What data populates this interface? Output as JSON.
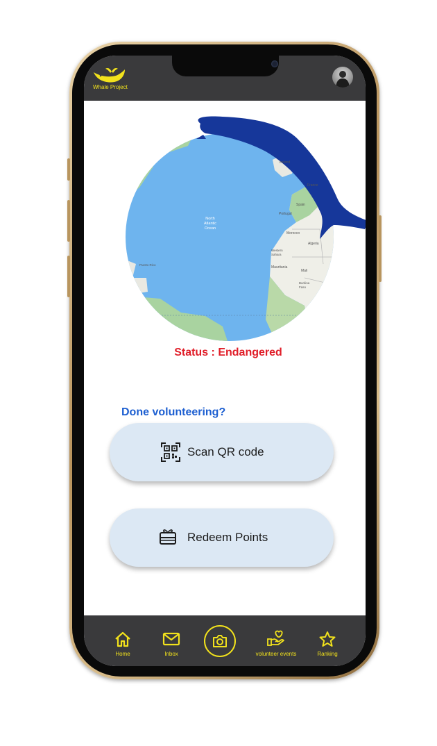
{
  "app": {
    "name": "Whale Project"
  },
  "map": {
    "labels": {
      "ocean": [
        "North",
        "Atlantic",
        "Ocean"
      ],
      "ireland": "Ireland",
      "france": "France",
      "spain": "Spain",
      "portugal": "Portugal",
      "morocco": "Morocco",
      "algeria": "Algeria",
      "western_sahara": [
        "Western",
        "Sahara"
      ],
      "mauritania": "Mauritania",
      "mali": "Mali",
      "burkina_faso": [
        "Burkina",
        "Faso"
      ],
      "puerto_rico": "Puerto Rico"
    }
  },
  "status": {
    "text": "Status : Endangered",
    "color": "#e01d28"
  },
  "volunteer": {
    "question": "Done volunteering?",
    "scan_label": "Scan QR code",
    "redeem_label": "Redeem Points"
  },
  "nav": {
    "home": "Home",
    "inbox": "Inbox",
    "volunteer_events": "volunteer events",
    "ranking": "Ranking"
  },
  "colors": {
    "accent": "#f2e21c",
    "bar": "#3a3a3c",
    "question": "#1d5fd1",
    "pill": "#dce8f4",
    "whale": "#16379a",
    "ocean": "#6eb4ee"
  }
}
